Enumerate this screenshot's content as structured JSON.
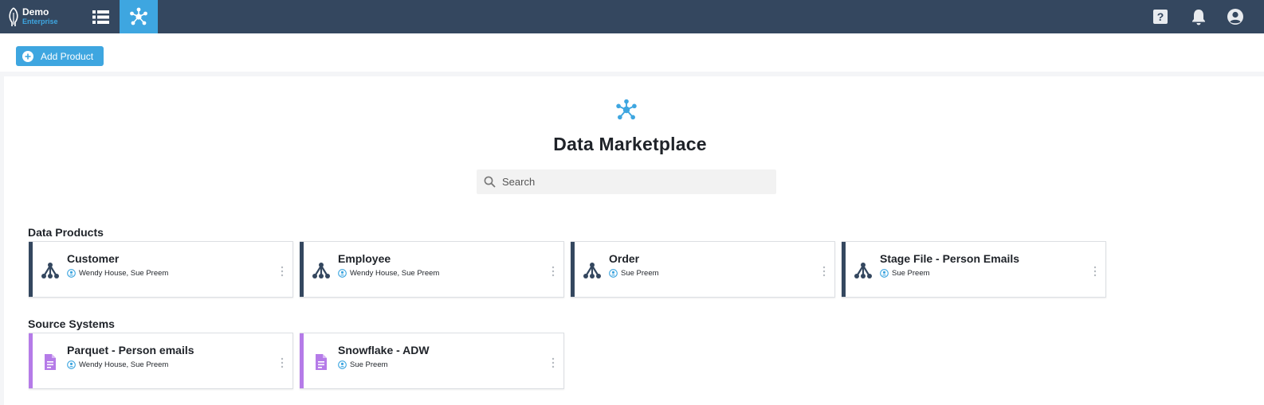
{
  "app": {
    "name": "Demo",
    "tier": "Enterprise"
  },
  "colors": {
    "topbar": "#34475f",
    "accent": "#3ea6e0",
    "product_accent": "#34475f",
    "source_accent": "#b57be8"
  },
  "nav": [
    {
      "name": "list-view",
      "icon": "list-icon",
      "active": false
    },
    {
      "name": "data-marketplace",
      "icon": "network-icon",
      "active": true
    }
  ],
  "topbar_right": [
    {
      "icon": "help-icon"
    },
    {
      "icon": "bell-icon"
    },
    {
      "icon": "account-circle-icon"
    }
  ],
  "toolbar": {
    "add_product_label": "Add Product"
  },
  "page": {
    "title": "Data Marketplace",
    "search_placeholder": "Search"
  },
  "sections": [
    {
      "title": "Data Products",
      "items": [
        {
          "title": "Customer",
          "owners": "Wendy House, Sue Preem",
          "icon": "hierarchy-icon"
        },
        {
          "title": "Employee",
          "owners": "Wendy House, Sue Preem",
          "icon": "hierarchy-icon"
        },
        {
          "title": "Order",
          "owners": "Sue Preem",
          "icon": "hierarchy-icon"
        },
        {
          "title": "Stage File - Person Emails",
          "owners": "Sue Preem",
          "icon": "hierarchy-icon"
        }
      ]
    },
    {
      "title": "Source Systems",
      "items": [
        {
          "title": "Parquet - Person emails",
          "owners": "Wendy House, Sue Preem",
          "icon": "file-icon"
        },
        {
          "title": "Snowflake - ADW",
          "owners": "Sue Preem",
          "icon": "file-icon"
        }
      ]
    }
  ]
}
